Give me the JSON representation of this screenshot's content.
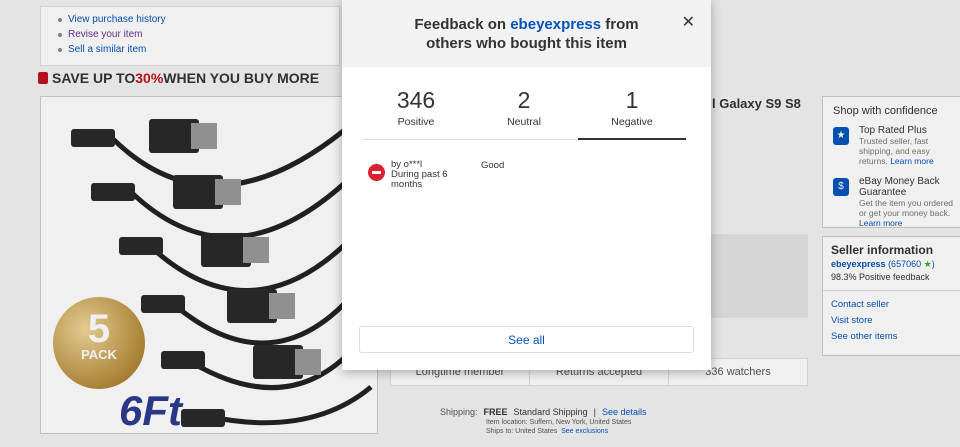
{
  "background": {
    "item_links": [
      {
        "label": "View purchase history"
      },
      {
        "label": "Revise your item"
      },
      {
        "label": "Sell a similar item"
      }
    ],
    "promo": {
      "prefix": "SAVE UP TO ",
      "percent": "30%",
      "suffix": " WHEN YOU BUY MORE"
    },
    "image_badge": {
      "number": "5",
      "pack": "PACK",
      "length": "6Ft"
    },
    "title_fragment": "l Galaxy S9 S8",
    "stats": [
      "Longtime member",
      "Returns accepted",
      "336 watchers"
    ],
    "shipping": {
      "label": "Shipping:",
      "free": "FREE",
      "method": "Standard Shipping",
      "details_link": "See details",
      "location": "Item location:  Suffern, New York, United States",
      "ships_to": "Ships to:  United States",
      "exclusions_link": "See exclusions"
    },
    "confidence": {
      "header": "Shop with confidence",
      "items": [
        {
          "title": "Top Rated Plus",
          "desc": "Trusted seller, fast shipping, and easy returns.",
          "link": "Learn more",
          "icon": "top-rated-icon"
        },
        {
          "title": "eBay Money Back Guarantee",
          "desc": "Get the item you ordered or get your money back.",
          "link": "Learn more",
          "icon": "money-back-icon"
        }
      ]
    },
    "seller_info": {
      "header": "Seller information",
      "name": "ebeyexpress",
      "score": "(657060",
      "feedback": "98.3% Positive feedback",
      "links": [
        "Contact seller",
        "Visit store",
        "See other items"
      ]
    }
  },
  "modal": {
    "title_prefix": "Feedback on ",
    "seller_name": "ebeyexpress",
    "title_suffix": " from",
    "title_line2": "others who bought this item",
    "close_icon": "close-icon",
    "tabs": [
      {
        "count": "346",
        "label": "Positive"
      },
      {
        "count": "2",
        "label": "Neutral"
      },
      {
        "count": "1",
        "label": "Negative",
        "active": true
      }
    ],
    "entry": {
      "icon": "negative-feedback-icon",
      "by": "by o***l",
      "period": "During past 6 months",
      "comment": "Good"
    },
    "see_all_label": "See all"
  }
}
